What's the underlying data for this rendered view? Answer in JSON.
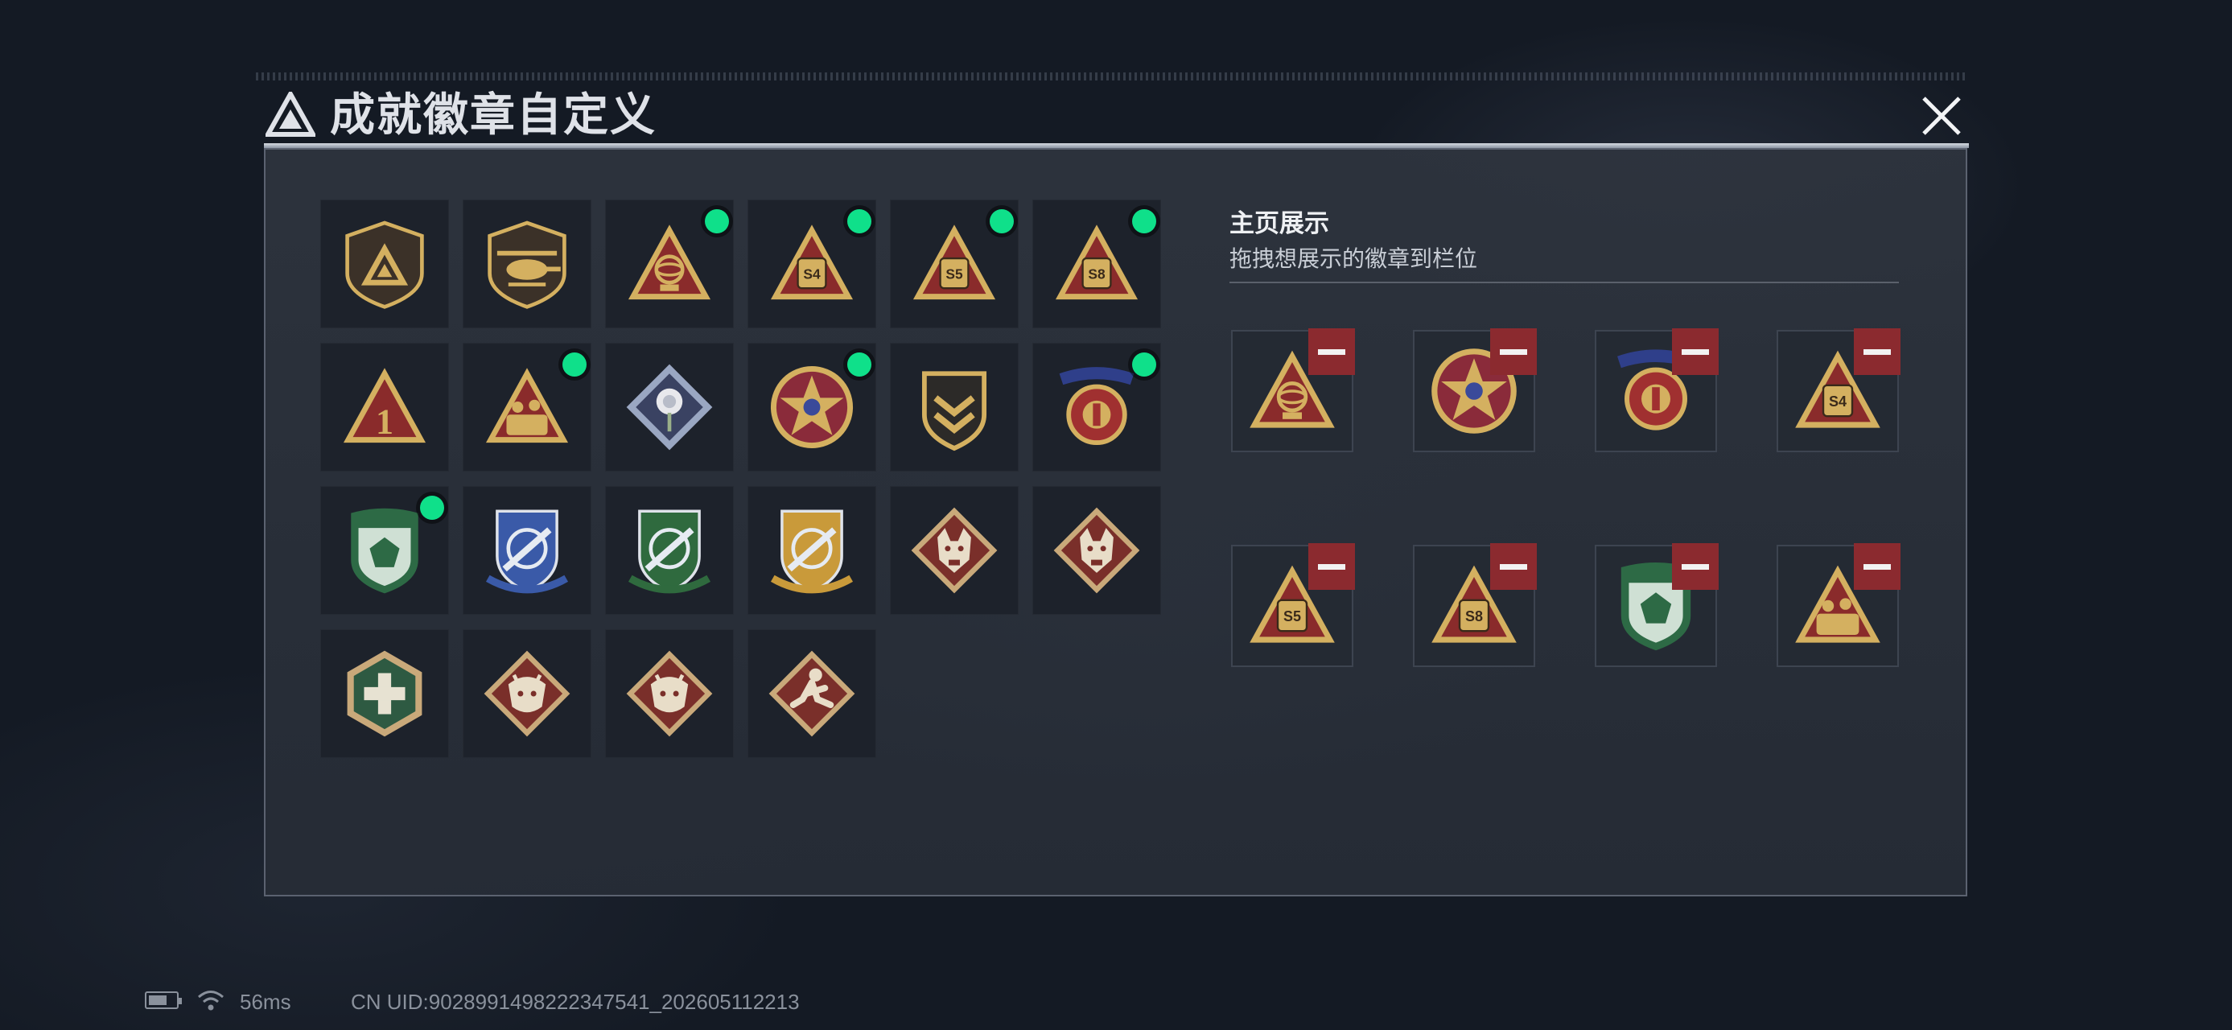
{
  "header": {
    "title": "成就徽章自定义",
    "close_icon": "close-x-icon"
  },
  "colors": {
    "online_dot": "#0fe08a",
    "remove_button": "#8b2a2f",
    "gold": "#d4b060",
    "red": "#8a2b2b"
  },
  "badge_grid": [
    {
      "icon": "triangle-emblem-shield-badge",
      "new": false
    },
    {
      "icon": "helicopter-badge",
      "new": false
    },
    {
      "icon": "gyroscope-triangle-badge",
      "new": true
    },
    {
      "icon": "s4-triangle-badge",
      "new": true
    },
    {
      "icon": "s5-triangle-badge",
      "new": true
    },
    {
      "icon": "s8-triangle-badge",
      "new": true
    },
    {
      "icon": "number-one-triangle-badge",
      "new": false
    },
    {
      "icon": "soldiers-triangle-badge",
      "new": true
    },
    {
      "icon": "white-rose-diamond-badge",
      "new": false
    },
    {
      "icon": "star-medal-badge",
      "new": true
    },
    {
      "icon": "chevron-shield-badge",
      "new": false
    },
    {
      "icon": "laurel-crest-badge",
      "new": true
    },
    {
      "icon": "green-gem-shield-badge",
      "new": true
    },
    {
      "icon": "blue-rifle-crest-badge",
      "new": false
    },
    {
      "icon": "green-rifle-crest-badge",
      "new": false
    },
    {
      "icon": "gold-rifle-crest-badge",
      "new": false
    },
    {
      "icon": "wolf-diamond-badge",
      "new": false
    },
    {
      "icon": "wolf-diamond-badge-2",
      "new": false
    },
    {
      "icon": "medic-hexagon-badge",
      "new": false
    },
    {
      "icon": "dragon-diamond-badge",
      "new": false
    },
    {
      "icon": "dragon-diamond-badge-2",
      "new": false
    },
    {
      "icon": "runner-diamond-badge",
      "new": false
    }
  ],
  "display": {
    "title": "主页展示",
    "subtitle": "拖拽想展示的徽章到栏位",
    "slots": [
      {
        "icon": "gyroscope-triangle-badge"
      },
      {
        "icon": "star-medal-badge"
      },
      {
        "icon": "laurel-crest-badge"
      },
      {
        "icon": "s4-triangle-badge"
      },
      {
        "icon": "s5-triangle-badge"
      },
      {
        "icon": "s8-triangle-badge"
      },
      {
        "icon": "green-gem-shield-badge"
      },
      {
        "icon": "soldiers-triangle-badge"
      }
    ]
  },
  "status_bar": {
    "ping": "56ms",
    "uid": "CN UID:9028991498222347541_202605112213"
  }
}
